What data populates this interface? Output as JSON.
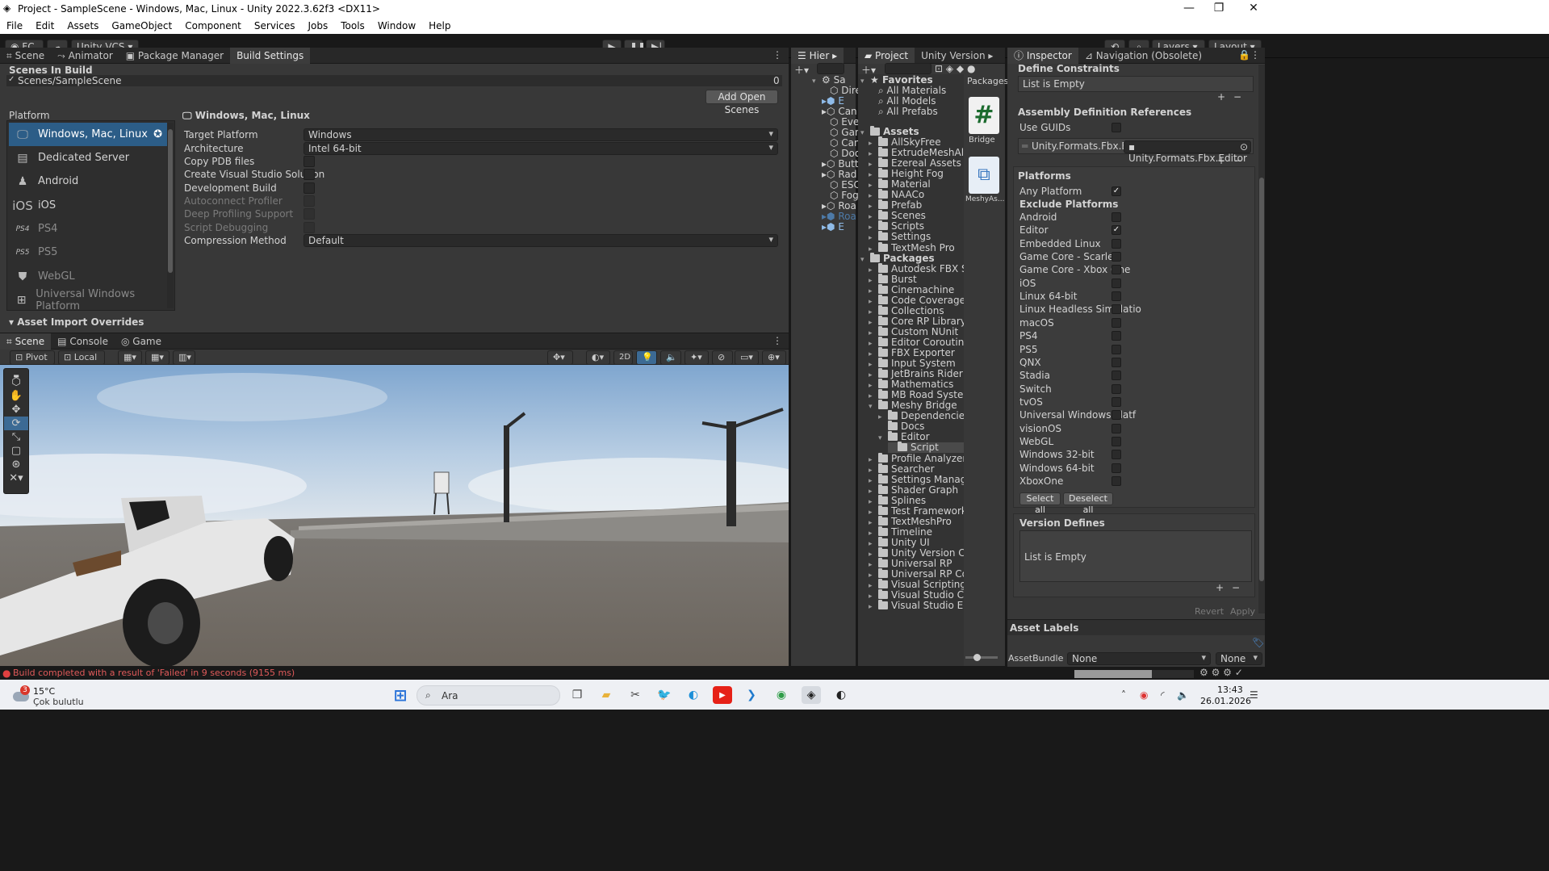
{
  "window": {
    "title": "Project - SampleScene - Windows, Mac, Linux - Unity 2022.3.62f3 <DX11>",
    "minimize": "—",
    "maximize": "❐",
    "close": "✕"
  },
  "menu": [
    "File",
    "Edit",
    "Assets",
    "GameObject",
    "Component",
    "Services",
    "Jobs",
    "Tools",
    "Window",
    "Help"
  ],
  "toolbar": {
    "account": "FÇ",
    "vcs": "Unity VCS",
    "layers": "Layers",
    "layout": "Layout"
  },
  "top_left_tabs": [
    "Scene",
    "Animator",
    "Package Manager",
    "Build Settings"
  ],
  "build": {
    "scenes_in_build": "Scenes In Build",
    "scene_path": "Scenes/SampleScene",
    "scene_index": "0",
    "add_open_scenes": "Add Open Scenes",
    "platform_header": "Platform",
    "platforms": [
      {
        "name": "Windows, Mac, Linux",
        "icon": "monitor-icon",
        "glyph": "🖵"
      },
      {
        "name": "Dedicated Server",
        "icon": "server-icon",
        "glyph": "▤"
      },
      {
        "name": "Android",
        "icon": "android-icon",
        "glyph": "🤖"
      },
      {
        "name": "iOS",
        "icon": "ios-icon",
        "glyph": "iOS"
      },
      {
        "name": "PS4",
        "icon": "ps4-icon",
        "glyph": "PS4"
      },
      {
        "name": "PS5",
        "icon": "ps5-icon",
        "glyph": "PS5"
      },
      {
        "name": "WebGL",
        "icon": "html5-icon",
        "glyph": "5"
      },
      {
        "name": "Universal Windows Platform",
        "icon": "windows-icon",
        "glyph": "⊞"
      }
    ],
    "asset_import_overrides": "Asset Import Overrides",
    "selected_title": "Windows, Mac, Linux",
    "settings": [
      {
        "label": "Target Platform",
        "value": "Windows"
      },
      {
        "label": "Architecture",
        "value": "Intel 64-bit"
      },
      {
        "label": "Copy PDB files",
        "value": ""
      },
      {
        "label": "Create Visual Studio Solution",
        "value": ""
      },
      {
        "label": "Development Build",
        "value": ""
      },
      {
        "label": "Autoconnect Profiler",
        "value": ""
      },
      {
        "label": "Deep Profiling Support",
        "value": ""
      },
      {
        "label": "Script Debugging",
        "value": ""
      },
      {
        "label": "Compression Method",
        "value": "Default"
      }
    ]
  },
  "bottom_tabs": [
    "Scene",
    "Console",
    "Game"
  ],
  "scene_toolbar": {
    "pivot": "Pivot",
    "local": "Local",
    "mode2d": "2D"
  },
  "hierarchy": {
    "tab": "Hier",
    "root": "Sa",
    "items": [
      "Dire",
      "E",
      "Can",
      "Eve",
      "Gan",
      "Can",
      "Doo",
      "Butt",
      "Rad",
      "ESC",
      "Fog",
      "Roa",
      "Roa",
      "E"
    ]
  },
  "project": {
    "tabs": [
      "Project",
      "Unity Version"
    ],
    "favorites_header": "Favorites",
    "favorites": [
      "All Materials",
      "All Models",
      "All Prefabs"
    ],
    "assets_header": "Assets",
    "assets": [
      "AllSkyFree",
      "ExtrudeMeshAlongB",
      "Ezereal Assets",
      "Height Fog",
      "Material",
      "NAACo",
      "Prefab",
      "Scenes",
      "Scripts",
      "Settings",
      "TextMesh Pro"
    ],
    "packages_header": "Packages",
    "packages": [
      "Autodesk FBX SDK f",
      "Burst",
      "Cinemachine",
      "Code Coverage",
      "Collections",
      "Core RP Library",
      "Custom NUnit",
      "Editor Coroutines",
      "FBX Exporter",
      "Input System",
      "JetBrains Rider Edito",
      "Mathematics",
      "MB Road System",
      "Meshy Bridge"
    ],
    "meshy_children": [
      "Dependencies",
      "Docs",
      "Editor"
    ],
    "editor_children": [
      "Script"
    ],
    "packages_after": [
      "Profile Analyzer",
      "Searcher",
      "Settings Manager",
      "Shader Graph",
      "Splines",
      "Test Framework",
      "TextMeshPro",
      "Timeline",
      "Unity UI",
      "Unity Version Contro",
      "Universal RP",
      "Universal RP Config",
      "Visual Scripting",
      "Visual Studio Code E",
      "Visual Studio Editor"
    ],
    "breadcrumb": "Packages",
    "files": [
      {
        "name": "Bridge",
        "glyph": "#"
      },
      {
        "name": "MeshyAs...",
        "glyph": "⧉"
      }
    ]
  },
  "inspector": {
    "tabs": [
      "Inspector",
      "Navigation (Obsolete)"
    ],
    "define_constraints": "Define Constraints",
    "list_empty": "List is Empty",
    "asm_refs": "Assembly Definition References",
    "use_guids": "Use GUIDs",
    "ref_name": "Unity.Formats.Fbx.Editor",
    "ref_value": "Unity.Formats.Fbx.Editor",
    "platforms_header": "Platforms",
    "any_platform": "Any Platform",
    "exclude_platforms": "Exclude Platforms",
    "platform_list": [
      {
        "name": "Android",
        "checked": ""
      },
      {
        "name": "Editor",
        "checked": "✓"
      },
      {
        "name": "Embedded Linux",
        "checked": ""
      },
      {
        "name": "Game Core - Scarlett",
        "checked": ""
      },
      {
        "name": "Game Core - Xbox One",
        "checked": ""
      },
      {
        "name": "iOS",
        "checked": ""
      },
      {
        "name": "Linux 64-bit",
        "checked": ""
      },
      {
        "name": "Linux Headless Simulatio",
        "checked": ""
      },
      {
        "name": "macOS",
        "checked": ""
      },
      {
        "name": "PS4",
        "checked": ""
      },
      {
        "name": "PS5",
        "checked": ""
      },
      {
        "name": "QNX",
        "checked": ""
      },
      {
        "name": "Stadia",
        "checked": ""
      },
      {
        "name": "Switch",
        "checked": ""
      },
      {
        "name": "tvOS",
        "checked": ""
      },
      {
        "name": "Universal Windows Platf",
        "checked": ""
      },
      {
        "name": "visionOS",
        "checked": ""
      },
      {
        "name": "WebGL",
        "checked": ""
      },
      {
        "name": "Windows 32-bit",
        "checked": ""
      },
      {
        "name": "Windows 64-bit",
        "checked": ""
      },
      {
        "name": "XboxOne",
        "checked": ""
      }
    ],
    "select_all": "Select all",
    "deselect_all": "Deselect all",
    "version_defines": "Version Defines",
    "revert": "Revert",
    "apply": "Apply",
    "asset_labels": "Asset Labels",
    "assetbundle_label": "AssetBundle",
    "assetbundle_value": "None",
    "assetbundle_variant": "None",
    "add": "+",
    "remove": "−"
  },
  "status": {
    "message": "Build completed with a result of 'Failed' in 9 seconds (9155 ms)",
    "error_color": "#e04040"
  },
  "taskbar": {
    "weather_badge": "3",
    "temperature": "15°C",
    "condition": "Çok bulutlu",
    "search": "Ara",
    "time": "13:43",
    "date": "26.01.2026"
  }
}
